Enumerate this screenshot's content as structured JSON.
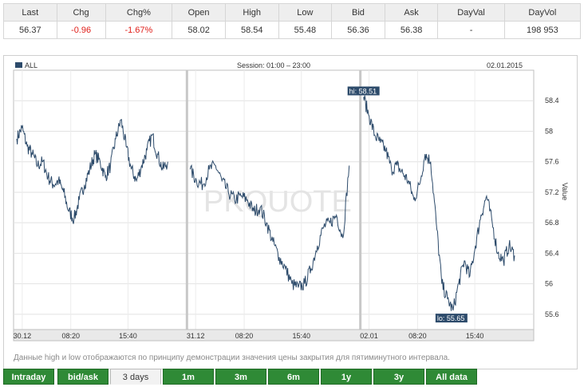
{
  "quote": {
    "headers": [
      "Last",
      "Chg",
      "Chg%",
      "Open",
      "High",
      "Low",
      "Bid",
      "Ask",
      "DayVal",
      "DayVol"
    ],
    "values": [
      "56.37",
      "-0.96",
      "-1.67%",
      "58.02",
      "58.54",
      "55.48",
      "56.36",
      "56.38",
      "-",
      "198 953"
    ],
    "negative_color": "#e0201b"
  },
  "chart": {
    "legend_label": "ALL",
    "session_label": "Session: 01:00 – 23:00",
    "date_label": "02.01.2015",
    "watermark": "PKQUOTE",
    "y_axis_title": "Value",
    "hi_label": "hi: 58.51",
    "lo_label": "lo: 55.65",
    "note": "Данные high и low отображаются по принципу демонстрации значения цены закрытия для пятиминутного интервала.",
    "line_color": "#2d4b6b"
  },
  "chart_data": {
    "type": "line",
    "ylabel": "Value",
    "ylim": [
      55.4,
      58.8
    ],
    "yticks": [
      "58.4",
      "58",
      "57.6",
      "57.2",
      "56.8",
      "56.4",
      "56",
      "55.6"
    ],
    "xticks": [
      "30.12",
      "08:20",
      "15:40",
      "31.12",
      "08:20",
      "15:40",
      "02.01",
      "08:20",
      "15:40"
    ],
    "grid": true,
    "days": [
      {
        "label": "30.12",
        "values": [
          57.9,
          58.05,
          57.8,
          57.7,
          57.55,
          57.6,
          57.4,
          57.3,
          57.35,
          57.2,
          56.95,
          56.85,
          57.1,
          57.3,
          57.5,
          57.7,
          57.6,
          57.4,
          57.55,
          57.9,
          58.15,
          57.8,
          57.5,
          57.35,
          57.55,
          57.75,
          57.95,
          57.7,
          57.5,
          57.6
        ]
      },
      {
        "label": "31.12",
        "values": [
          57.5,
          57.35,
          57.3,
          57.5,
          57.55,
          57.35,
          57.2,
          57.1,
          57.15,
          57.1,
          56.95,
          57.0,
          56.8,
          56.55,
          56.35,
          56.2,
          56.0,
          55.95,
          56.0,
          56.2,
          56.5,
          56.75,
          56.8,
          56.9,
          56.6,
          57.55
        ]
      },
      {
        "label": "02.01",
        "values": [
          58.45,
          58.2,
          57.95,
          57.85,
          57.75,
          57.5,
          57.55,
          57.45,
          57.35,
          57.1,
          57.3,
          57.7,
          57.6,
          56.8,
          56.0,
          55.8,
          55.65,
          56.0,
          56.3,
          56.1,
          56.5,
          56.9,
          57.15,
          56.8,
          56.4,
          56.3,
          56.5,
          56.37
        ]
      }
    ]
  },
  "tabs": {
    "items": [
      "Intraday",
      "bid/ask",
      "3 days",
      "1m",
      "3m",
      "6m",
      "1y",
      "3y",
      "All data"
    ],
    "active": "3 days"
  }
}
